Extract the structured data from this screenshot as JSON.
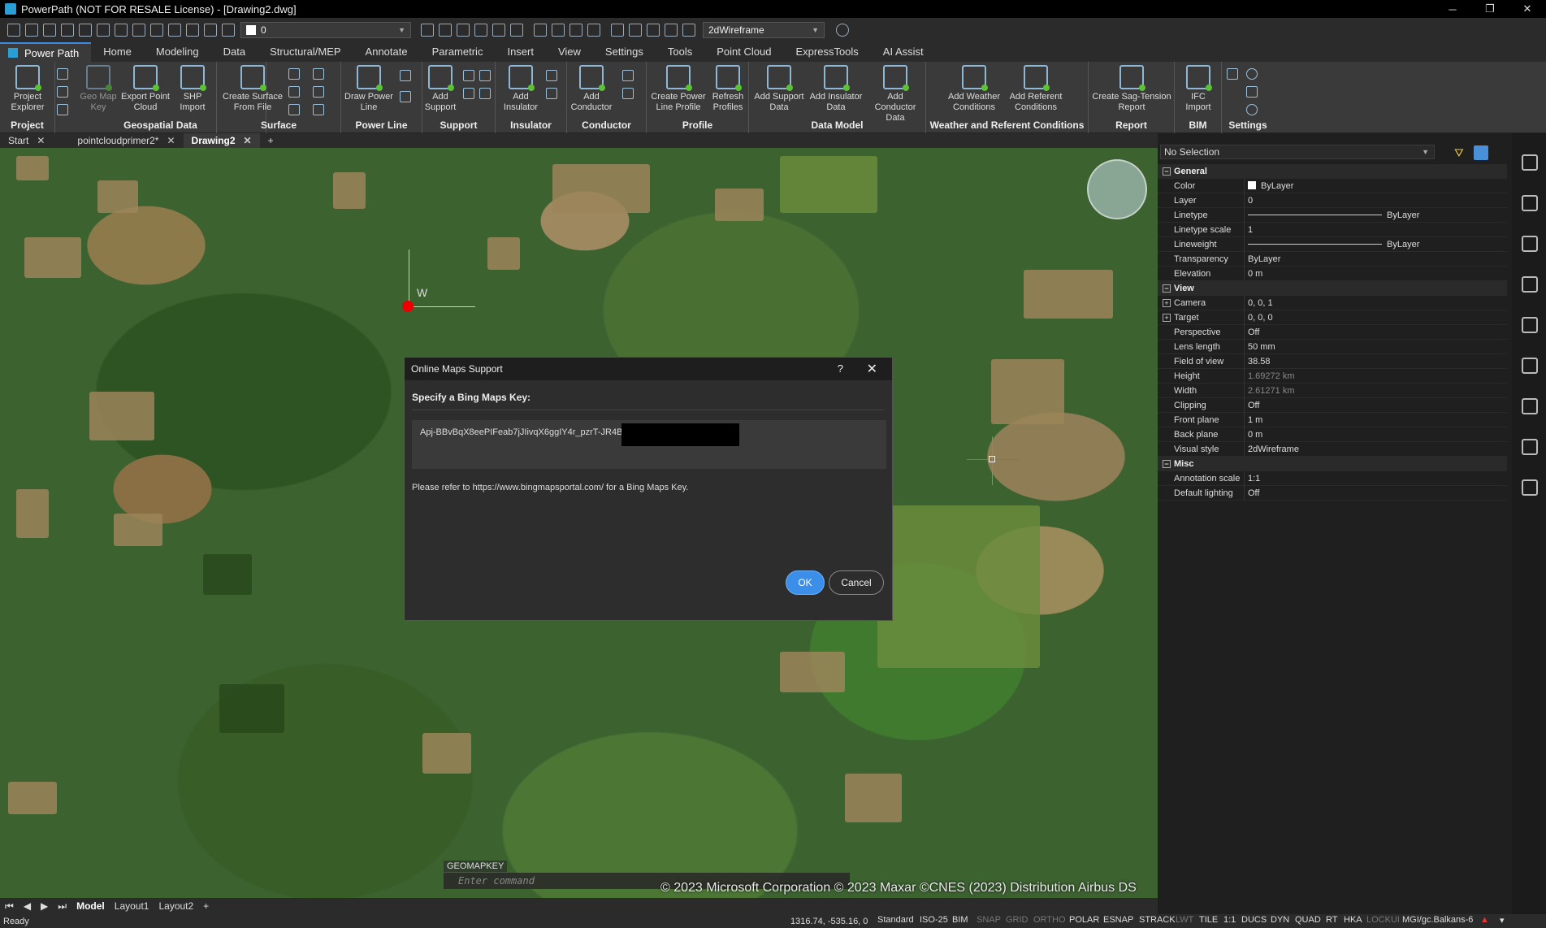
{
  "window": {
    "title": "PowerPath (NOT FOR RESALE License) - [Drawing2.dwg]",
    "minimize": "─",
    "restore": "❐",
    "close": "✕"
  },
  "qat": {
    "layer_value": "0",
    "visual_style": "2dWireframe"
  },
  "tabs": [
    "Power Path",
    "Home",
    "Modeling",
    "Data",
    "Structural/MEP",
    "Annotate",
    "Parametric",
    "Insert",
    "View",
    "Settings",
    "Tools",
    "Point Cloud",
    "ExpressTools",
    "AI Assist"
  ],
  "ribbon": {
    "groups": [
      "Project",
      "Geospatial Data",
      "Surface",
      "Power Line",
      "Support",
      "Insulator",
      "Conductor",
      "Profile",
      "Data Model",
      "Weather and Referent Conditions",
      "Report",
      "BIM",
      "Settings"
    ],
    "buttons": [
      "Project Explorer",
      "Geo Map Key",
      "Export Point Cloud",
      "SHP Import",
      "Create Surface From File",
      "Draw Power Line",
      "Add Support",
      "Add Insulator",
      "Add Conductor",
      "Create Power Line Profile",
      "Refresh Profiles",
      "Add Support Data",
      "Add Insulator Data",
      "Add Conductor Data",
      "Add Weather Conditions",
      "Add Referent Conditions",
      "Create Sag-Tension Report",
      "IFC Import"
    ]
  },
  "doc_tabs": [
    "Start",
    "pointcloudprimer2*",
    "Drawing2"
  ],
  "doc_tab_add": "+",
  "viewport": {
    "ucs_label": "W",
    "copyright": "© 2023 Microsoft Corporation © 2023 Maxar ©CNES (2023) Distribution Airbus DS",
    "cmd_history": "GEOMAPKEY",
    "cmd_placeholder": "Enter command"
  },
  "dialog": {
    "title": "Online Maps Support",
    "help": "?",
    "close": "✕",
    "label": "Specify a Bing Maps Key:",
    "key_value": "Apj-BBvBqX8eePIFeab7jJIivqX6ggIY4r_pzrT-JR4BZ",
    "refer_text": "Please refer to https://www.bingmapsportal.com/ for a Bing Maps Key.",
    "ok": "OK",
    "cancel": "Cancel"
  },
  "properties": {
    "selection": "No Selection",
    "rows": [
      {
        "section": "General"
      },
      {
        "k": "Color",
        "v": "ByLayer"
      },
      {
        "k": "Layer",
        "v": "0"
      },
      {
        "k": "Linetype",
        "v": "ByLayer"
      },
      {
        "k": "Linetype scale",
        "v": "1"
      },
      {
        "k": "Lineweight",
        "v": "ByLayer"
      },
      {
        "k": "Transparency",
        "v": "ByLayer"
      },
      {
        "k": "Elevation",
        "v": "0 m"
      },
      {
        "section": "View"
      },
      {
        "k": "Camera",
        "v": "0, 0, 1"
      },
      {
        "k": "Target",
        "v": "0, 0, 0"
      },
      {
        "k": "Perspective",
        "v": "Off"
      },
      {
        "k": "Lens length",
        "v": "50 mm"
      },
      {
        "k": "Field of view",
        "v": "38.58"
      },
      {
        "k": "Height",
        "v": "1.69272 km"
      },
      {
        "k": "Width",
        "v": "2.61271 km"
      },
      {
        "k": "Clipping",
        "v": "Off"
      },
      {
        "k": "Front plane",
        "v": "1 m"
      },
      {
        "k": "Back plane",
        "v": "0 m"
      },
      {
        "k": "Visual style",
        "v": "2dWireframe"
      },
      {
        "section": "Misc"
      },
      {
        "k": "Annotation scale",
        "v": "1:1"
      },
      {
        "k": "Default lighting",
        "v": "Off"
      }
    ]
  },
  "layout_tabs": [
    "Model",
    "Layout1",
    "Layout2"
  ],
  "status": {
    "ready": "Ready",
    "coords": "1316.74, -535.16, 0",
    "items": [
      "Standard",
      "ISO-25",
      "BIM",
      "SNAP",
      "GRID",
      "ORTHO",
      "POLAR",
      "ESNAP",
      "STRACK",
      "LWT",
      "TILE",
      "1:1",
      "DUCS",
      "DYN",
      "QUAD",
      "RT",
      "HKA",
      "LOCKUI",
      "MGI/gc.Balkans-6"
    ]
  }
}
